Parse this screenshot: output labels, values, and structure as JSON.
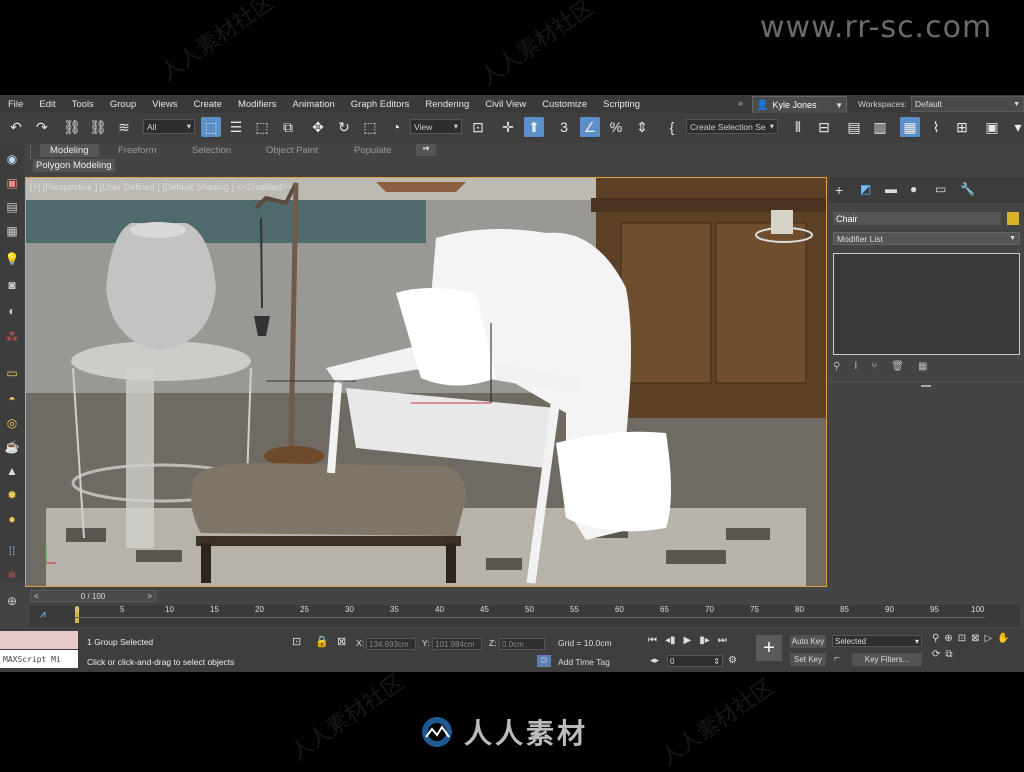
{
  "watermark": {
    "url": "www.rr-sc.com",
    "logo_text": "人人素材",
    "tile_text": "人人素材社区"
  },
  "menu": [
    "File",
    "Edit",
    "Tools",
    "Group",
    "Views",
    "Create",
    "Modifiers",
    "Animation",
    "Graph Editors",
    "Rendering",
    "Civil View",
    "Customize",
    "Scripting"
  ],
  "user": {
    "name": "Kyle Jones"
  },
  "workspace": {
    "label": "Workspaces:",
    "value": "Default"
  },
  "toolbar": {
    "filter": "All",
    "ref_coord": "View",
    "selection_set": "Create Selection Se"
  },
  "ribbon": {
    "tabs": [
      "Modeling",
      "Freeform",
      "Selection",
      "Object Paint",
      "Populate"
    ],
    "active_tab": "Modeling",
    "sub_label": "Polygon Modeling"
  },
  "viewport": {
    "label": "[+] [Perspective ] [User Defined ] [Default Shading ]  <<Disabled>>"
  },
  "command_panel": {
    "object_name": "Chair",
    "object_color": "#d8b22a",
    "modifier_list": "Modifier List"
  },
  "timeline": {
    "frame": "0 / 100",
    "ticks": [
      "0",
      "5",
      "10",
      "15",
      "20",
      "25",
      "30",
      "35",
      "40",
      "45",
      "50",
      "55",
      "60",
      "65",
      "70",
      "75",
      "80",
      "85",
      "90",
      "95",
      "100"
    ]
  },
  "status": {
    "maxscript": "MAXScript Mi",
    "selected": "1 Group Selected",
    "prompt": "Click or click-and-drag to select objects",
    "x_label": "X:",
    "x": "134.693cm",
    "y_label": "Y:",
    "y": "101.984cm",
    "z_label": "Z:",
    "z": "0.0cm",
    "grid": "Grid = 10.0cm",
    "add_time_tag": "Add Time Tag",
    "auto_key": "Auto Key",
    "set_key": "Set Key",
    "key_mode": "Selected",
    "key_filters": "Key Filters...",
    "frame_field": "0"
  }
}
